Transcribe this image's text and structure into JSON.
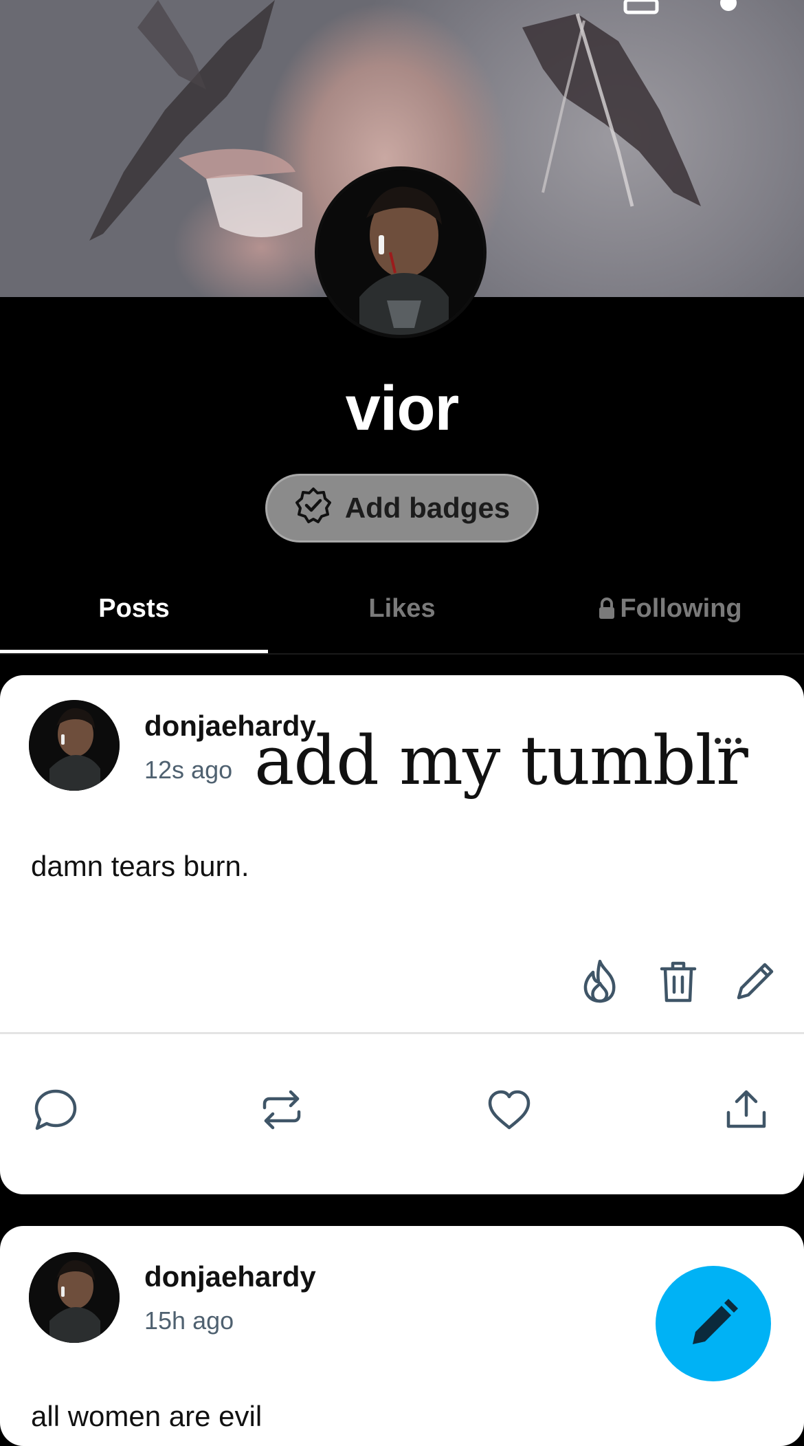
{
  "profile": {
    "name": "vior",
    "add_badges_label": "Add badges"
  },
  "tabs": [
    {
      "label": "Posts",
      "active": true
    },
    {
      "label": "Likes",
      "active": false
    },
    {
      "label": "Following",
      "active": false,
      "locked": true
    }
  ],
  "posts": [
    {
      "username": "donjaehardy",
      "time": "12s ago",
      "overlay_text": "add my tumblr",
      "text": "damn tears burn.",
      "owner_actions": [
        "flame-icon",
        "trash-icon",
        "edit-pencil-icon"
      ],
      "actions": [
        "comment-icon",
        "reblog-icon",
        "like-heart-icon",
        "share-icon"
      ]
    },
    {
      "username": "donjaehardy",
      "time": "15h ago",
      "text": "all women are evil"
    }
  ],
  "colors": {
    "fab": "#00b2f5",
    "icon_stroke": "#3f5567",
    "timestamp": "#4f6170"
  }
}
